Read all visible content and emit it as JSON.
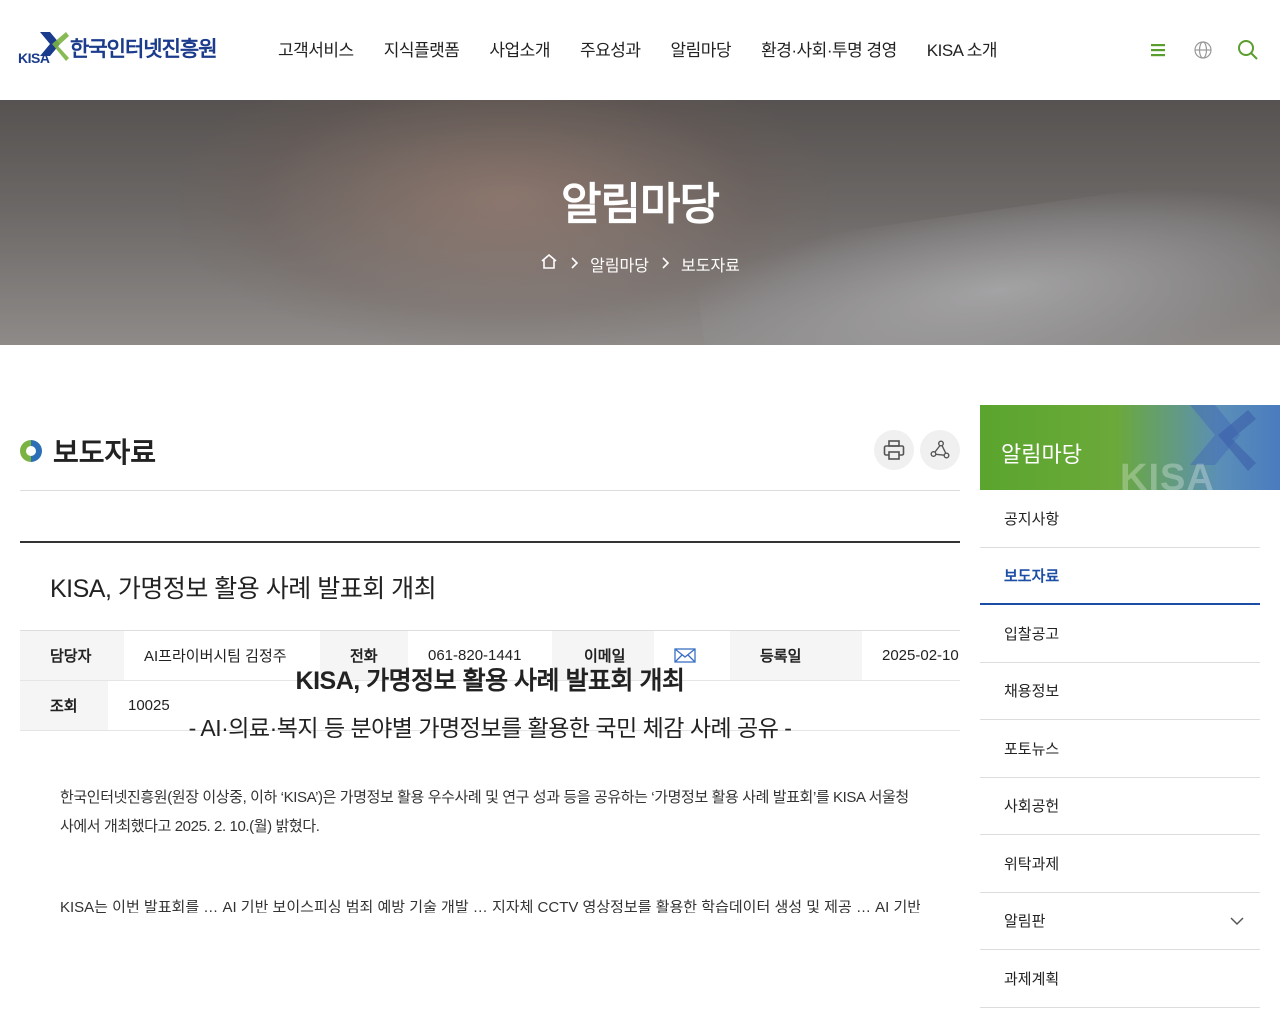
{
  "header": {
    "logo_mark": "KISA",
    "logo_text": "한국인터넷진흥원",
    "nav": [
      "고객서비스",
      "지식플랫폼",
      "사업소개",
      "주요성과",
      "알림마당",
      "환경·사회·투명 경영",
      "KISA 소개"
    ],
    "icons": [
      "hamburger-menu-icon",
      "globe-icon",
      "search-icon"
    ]
  },
  "visual": {
    "title": "알림마당",
    "breadcrumb": [
      "알림마당",
      "보도자료"
    ]
  },
  "main": {
    "page_title": "보도자료",
    "tools": [
      "print-icon",
      "share-icon"
    ],
    "subject": "KISA, 가명정보 활용 사례 발표회 개최",
    "meta": {
      "manager_label": "담당자",
      "manager_value": "AI프라이버시팀 김정주",
      "phone_label": "전화",
      "phone_value": "061-820-1441",
      "email_label": "이메일",
      "date_label": "등록일",
      "date_value": "2025-02-10",
      "views_label": "조회",
      "views_value": "10025"
    },
    "headline": "KISA, 가명정보 활용 사례 발표회 개최",
    "subhead": "- AI·의료·복지 등 분야별 가명정보를 활용한 국민 체감 사례 공유 -",
    "paragraph": "한국인터넷진흥원(원장 이상중, 이하 ‘KISA’)은 가명정보 활용 우수사례 및 연구 성과 등을 공유하는 ‘가명정보 활용 사례 발표회’를 KISA 서울청사에서 개최했다고 2025. 2. 10.(월) 밝혔다.",
    "paragraph2": "KISA는 이번 발표회를 … AI 기반 보이스피싱 범죄 예방 기술 개발 … 지자체 CCTV 영상정보를 활용한 학습데이터 생성 및 제공 … AI 기반 공익 공"
  },
  "sidebar": {
    "title": "알림마당",
    "watermark": "KISA",
    "items": [
      {
        "label": "공지사항"
      },
      {
        "label": "보도자료"
      },
      {
        "label": "입찰공고"
      },
      {
        "label": "채용정보"
      },
      {
        "label": "포토뉴스"
      },
      {
        "label": "사회공헌"
      },
      {
        "label": "위탁과제"
      },
      {
        "label": "알림판"
      },
      {
        "label": "과제계획"
      }
    ]
  },
  "colors": {
    "brand_navy": "#1b3c8c",
    "brand_green": "#7bb342",
    "active_blue": "#1c4ea6"
  }
}
